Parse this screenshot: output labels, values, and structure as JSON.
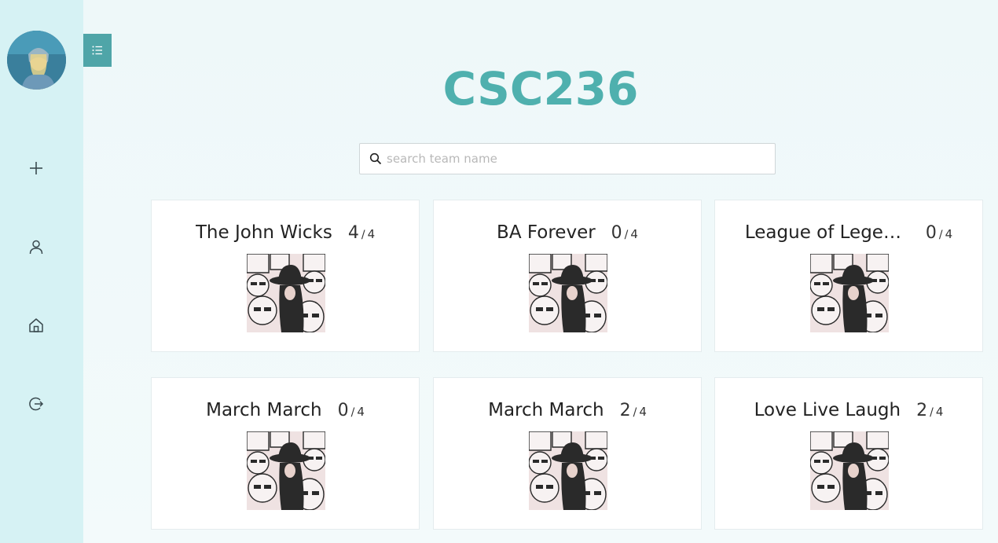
{
  "page": {
    "title": "CSC236"
  },
  "search": {
    "placeholder": "search team name",
    "value": ""
  },
  "sidebar": {
    "items": [
      {
        "name": "add",
        "icon": "plus-icon"
      },
      {
        "name": "profile",
        "icon": "user-icon"
      },
      {
        "name": "home",
        "icon": "home-icon"
      },
      {
        "name": "logout",
        "icon": "logout-icon"
      }
    ],
    "toggle_icon": "list-icon"
  },
  "teams": [
    {
      "name": "The John Wicks",
      "members": "4",
      "separator": "/",
      "max": "4"
    },
    {
      "name": "BA Forever",
      "members": "0",
      "separator": "/",
      "max": "4"
    },
    {
      "name": "League of Legen...",
      "members": "0",
      "separator": "/",
      "max": "4"
    },
    {
      "name": "March March",
      "members": "0",
      "separator": "/",
      "max": "4"
    },
    {
      "name": "March March",
      "members": "2",
      "separator": "/",
      "max": "4"
    },
    {
      "name": "Love Live Laugh",
      "members": "2",
      "separator": "/",
      "max": "4"
    }
  ],
  "colors": {
    "accent": "#4fb0ae",
    "sidebar": "#d6f2f4",
    "toggle": "#4fa5a8"
  }
}
